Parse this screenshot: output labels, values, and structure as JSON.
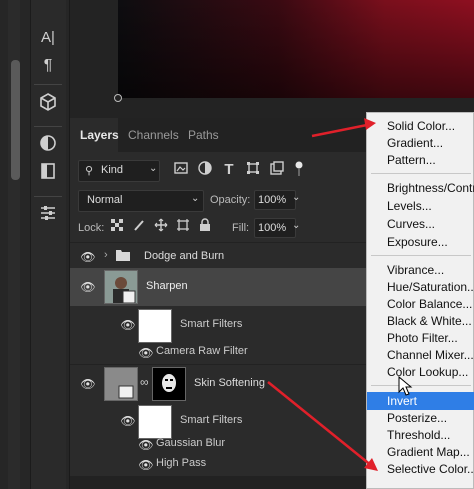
{
  "toolbar": {
    "icons": [
      "text-tool-icon",
      "paragraph-icon",
      "3d-cube-icon",
      "adjustments-circle-icon",
      "book-panel-icon",
      "sliders-icon"
    ],
    "text_tool_glyph": "A|",
    "paragraph_glyph": "¶"
  },
  "panel": {
    "tabs": [
      "Layers",
      "Channels",
      "Paths"
    ],
    "filter_label": "Kind",
    "blend_mode": "Normal",
    "opacity_label": "Opacity:",
    "opacity_value": "100%",
    "lock_label": "Lock:",
    "fill_label": "Fill:",
    "fill_value": "100%"
  },
  "layers": {
    "group_name": "Dodge and Burn",
    "sharpen_name": "Sharpen",
    "sharpen_smart_filters": "Smart Filters",
    "sharpen_filter": "Camera Raw Filter",
    "skin_name": "Skin Softening",
    "skin_smart_filters": "Smart Filters",
    "skin_filter_1": "Gaussian Blur",
    "skin_filter_2": "High Pass"
  },
  "menu": {
    "group1": [
      "Solid Color...",
      "Gradient...",
      "Pattern..."
    ],
    "group2": [
      "Brightness/Contr",
      "Levels...",
      "Curves...",
      "Exposure..."
    ],
    "group3": [
      "Vibrance...",
      "Hue/Saturation...",
      "Color Balance...",
      "Black & White...",
      "Photo Filter...",
      "Channel Mixer...",
      "Color Lookup..."
    ],
    "group4": [
      "Invert",
      "Posterize...",
      "Threshold...",
      "Gradient Map...",
      "Selective Color..."
    ],
    "highlighted": "Invert"
  },
  "colors": {
    "arrow": "#e0202a",
    "highlight": "#2f7ee6",
    "menu_bg": "#f1f1f1"
  }
}
